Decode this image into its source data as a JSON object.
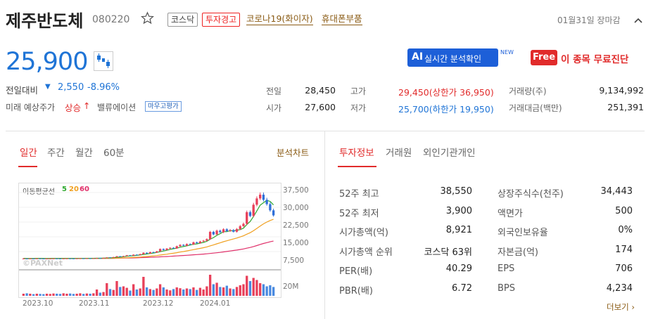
{
  "header": {
    "name": "제주반도체",
    "code": "080220",
    "market_tag": "코스닥",
    "warning_tag": "투자경고",
    "themes": [
      "코로나19(화이자)",
      "휴대폰부품"
    ],
    "timestamp": "01월31일 장마감"
  },
  "price": {
    "current": "25,900",
    "change_label": "전일대비",
    "change_arrow": "▼",
    "change_value": "2,550",
    "change_pct": "-8.96%",
    "forecast_label": "미래 예상주가",
    "forecast_value": "상승",
    "forecast_arrow": "↑",
    "valuation_label": "밸류에이션",
    "valuation_badge": "마우고평가"
  },
  "ai": {
    "badge": "AI",
    "label": "실시간 분석확인",
    "new": "NEW"
  },
  "free": {
    "badge": "Free",
    "label": "이 종목 무료진단"
  },
  "quote": {
    "prev_label": "전일",
    "prev": "28,450",
    "open_label": "시가",
    "open": "27,600",
    "high_label": "고가",
    "high": "29,450(상한가 36,950)",
    "low_label": "저가",
    "low": "25,700(하한가 19,950)",
    "vol_label": "거래량(주)",
    "vol": "9,134,992",
    "amt_label": "거래대금(백만)",
    "amt": "251,391"
  },
  "chart_panel": {
    "tabs": [
      "일간",
      "주간",
      "월간",
      "60분"
    ],
    "active_tab": 0,
    "analysis_link": "분석차트",
    "ma_label": "이동평균선",
    "ma": [
      "5",
      "20",
      "60"
    ],
    "ma_colors": [
      "#2ea82e",
      "#f0a020",
      "#e0306a"
    ],
    "watermark": "©PAXNet"
  },
  "chart_data": {
    "type": "candlestick",
    "x_labels": [
      "2023.10",
      "2023.11",
      "2023.12",
      "2024.01"
    ],
    "y_ticks": [
      "37,500",
      "30,000",
      "22,500",
      "15,000",
      "7,500"
    ],
    "ylim": [
      0,
      40000
    ],
    "volume_label": "20M",
    "close": [
      3950,
      3920,
      3960,
      3930,
      3980,
      3950,
      3920,
      3940,
      3960,
      3990,
      3950,
      3930,
      3970,
      4000,
      3980,
      3960,
      4010,
      4050,
      4020,
      4080,
      4060,
      4100,
      4200,
      4150,
      4300,
      4500,
      4400,
      4700,
      5100,
      4900,
      5200,
      5600,
      5400,
      5900,
      5700,
      6200,
      6900,
      6500,
      7200,
      7000,
      7600,
      8800,
      8300,
      9000,
      9400,
      9100,
      10200,
      10900,
      10500,
      11300,
      11100,
      12200,
      11800,
      12600,
      13000,
      13800,
      17500,
      16200,
      18100,
      17300,
      18800,
      17900,
      18400,
      17600,
      18900,
      20400,
      21600,
      27500,
      25600,
      31300,
      34500,
      36400,
      33800,
      31600,
      28450,
      25900
    ],
    "volume": [
      0.1,
      0.12,
      0.1,
      0.08,
      0.1,
      0.09,
      0.08,
      0.1,
      0.09,
      0.11,
      0.1,
      0.09,
      0.12,
      0.1,
      0.11,
      0.09,
      0.1,
      0.12,
      0.09,
      0.11,
      0.1,
      0.12,
      0.3,
      0.15,
      0.18,
      0.6,
      0.32,
      0.28,
      0.7,
      0.42,
      0.45,
      0.38,
      0.25,
      0.55,
      0.3,
      0.35,
      0.9,
      0.4,
      0.32,
      0.28,
      0.35,
      0.55,
      0.4,
      0.3,
      0.26,
      0.32,
      0.4,
      0.36,
      0.3,
      0.35,
      0.32,
      0.4,
      0.28,
      0.38,
      0.3,
      0.45,
      1.0,
      0.55,
      0.62,
      0.42,
      0.4,
      0.48,
      0.35,
      0.32,
      0.42,
      0.5,
      0.55,
      0.95,
      0.7,
      0.85,
      0.75,
      0.6,
      0.55,
      0.45,
      0.5,
      0.42
    ]
  },
  "invest_panel": {
    "tabs": [
      "투자정보",
      "거래원",
      "외인기관개인"
    ],
    "active_tab": 0,
    "left": [
      [
        "52주 최고",
        "38,550"
      ],
      [
        "52주 최저",
        "3,900"
      ],
      [
        "시가총액(억)",
        "8,921"
      ],
      [
        "시가총액 순위",
        "코스닥 63위"
      ],
      [
        "PER(배)",
        "40.29"
      ],
      [
        "PBR(배)",
        "6.72"
      ]
    ],
    "right": [
      [
        "상장주식수(천주)",
        "34,443"
      ],
      [
        "액면가",
        "500"
      ],
      [
        "외국인보유율",
        "0%"
      ],
      [
        "자본금(억)",
        "174"
      ],
      [
        "EPS",
        "706"
      ],
      [
        "BPS",
        "4,234"
      ]
    ],
    "more": "더보기"
  }
}
